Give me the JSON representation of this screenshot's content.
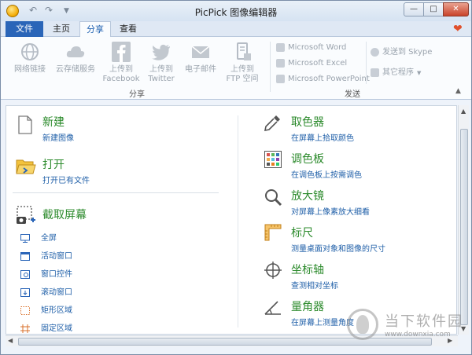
{
  "window": {
    "title": "PicPick 图像编辑器"
  },
  "tabs": [
    {
      "label": "文件"
    },
    {
      "label": "主页"
    },
    {
      "label": "分享"
    },
    {
      "label": "查看"
    }
  ],
  "ribbon": {
    "share_group": {
      "label": "分享",
      "buttons": [
        {
          "label": "网络链接",
          "icon": "globe-icon"
        },
        {
          "label": "云存储服务",
          "icon": "cloud-icon"
        },
        {
          "label": "上传到\nFacebook",
          "icon": "facebook-icon"
        },
        {
          "label": "上传到\nTwitter",
          "icon": "twitter-icon"
        },
        {
          "label": "电子邮件",
          "icon": "mail-icon"
        },
        {
          "label": "上传到\nFTP 空间",
          "icon": "ftp-icon"
        }
      ]
    },
    "send_group": {
      "label": "发送",
      "items": [
        {
          "label": "Microsoft Word",
          "icon": "word-icon"
        },
        {
          "label": "Microsoft Excel",
          "icon": "excel-icon"
        },
        {
          "label": "Microsoft PowerPoint",
          "icon": "powerpoint-icon"
        },
        {
          "label": "发送到 Skype",
          "icon": "skype-icon"
        },
        {
          "label": "其它程序",
          "icon": "apps-icon"
        }
      ]
    }
  },
  "left_panel": {
    "new": {
      "title": "新建",
      "link": "新建图像"
    },
    "open": {
      "title": "打开",
      "link": "打开已有文件"
    },
    "capture": {
      "title": "截取屏幕",
      "items": [
        {
          "label": "全屏"
        },
        {
          "label": "活动窗口"
        },
        {
          "label": "窗口控件"
        },
        {
          "label": "滚动窗口"
        },
        {
          "label": "矩形区域"
        },
        {
          "label": "固定区域"
        }
      ]
    }
  },
  "right_panel": {
    "tools": [
      {
        "title": "取色器",
        "link": "在屏幕上拾取颜色",
        "icon": "eyedropper-icon"
      },
      {
        "title": "调色板",
        "link": "在调色板上按需调色",
        "icon": "palette-icon"
      },
      {
        "title": "放大镜",
        "link": "对屏幕上像素放大细看",
        "icon": "magnifier-icon"
      },
      {
        "title": "标尺",
        "link": "测量桌面对象和图像的尺寸",
        "icon": "ruler-icon"
      },
      {
        "title": "坐标轴",
        "link": "查测相对坐标",
        "icon": "crosshair-icon"
      },
      {
        "title": "量角器",
        "link": "在屏幕上测量角度",
        "icon": "protractor-icon"
      }
    ]
  },
  "watermark": {
    "text": "当下软件园",
    "url": "www.downxia.com"
  },
  "colors": {
    "accent": "#2a65b8",
    "title_green": "#2b8a2b",
    "link_blue": "#1f5fa8"
  }
}
